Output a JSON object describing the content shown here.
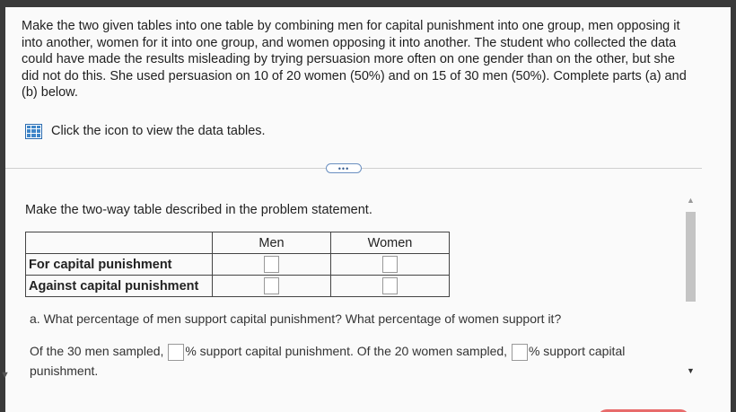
{
  "problem": {
    "text": "Make the two given tables into one table by combining men for capital punishment into one group, men opposing it into another, women for it into one group, and women opposing it into another. The student who collected the data could have made the results misleading by trying persuasion more often on one gender than on the other, but she did not do this. She used persuasion on 10 of 20 women (50%) and on 15 of 30 men (50%). Complete parts (a) and (b) below."
  },
  "data_link": {
    "icon": "table-icon",
    "label": "Click the icon to view the data tables."
  },
  "more_button": {
    "label": "•••"
  },
  "instruction": "Make the two-way table described in the problem statement.",
  "two_way_table": {
    "columns": [
      "Men",
      "Women"
    ],
    "rows": [
      {
        "label": "For capital punishment",
        "men": "",
        "women": ""
      },
      {
        "label": "Against capital punishment",
        "men": "",
        "women": ""
      }
    ]
  },
  "part_a": {
    "question": "a. What percentage of men support capital punishment? What percentage of women support it?",
    "answer_prefix": "Of the 30 men sampled,",
    "answer_mid": "% support capital punishment. Of the 20 women sampled,",
    "answer_suffix": "% support capital",
    "answer_end": "punishment.",
    "men_value": "",
    "women_value": ""
  },
  "colors": {
    "accent": "#2b6cb0",
    "background": "#fafafa",
    "button": "#e86b6b"
  }
}
